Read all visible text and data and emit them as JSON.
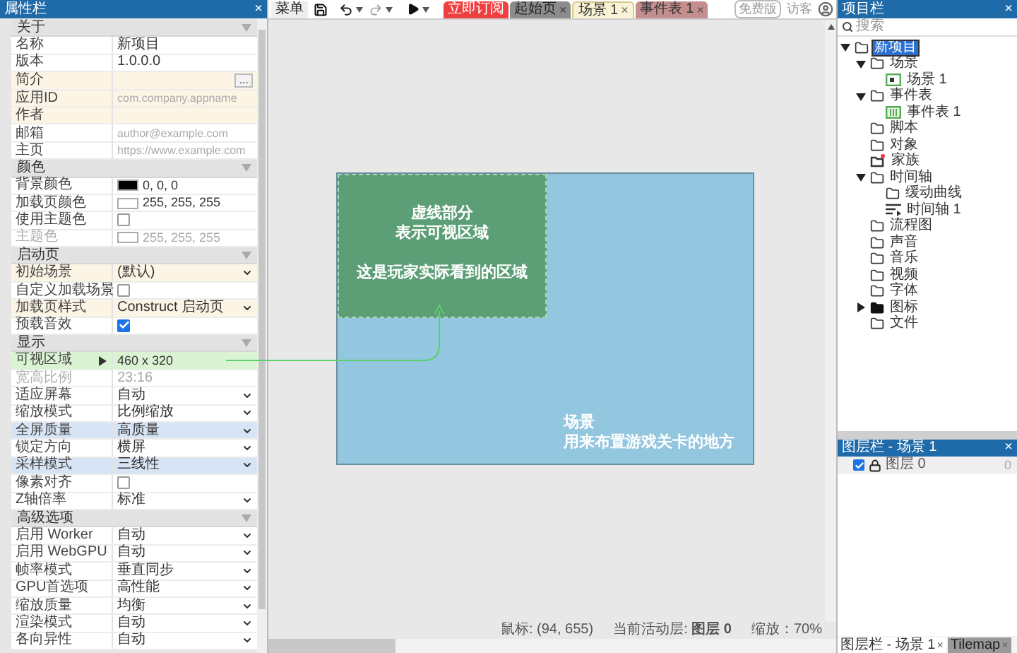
{
  "properties_panel": {
    "title": "属性栏",
    "close": "×",
    "rows": [
      {
        "kind": "section",
        "label": "关于",
        "expanded": true
      },
      {
        "kind": "text",
        "label": "名称",
        "value": "新项目"
      },
      {
        "kind": "text",
        "label": "版本",
        "value": "1.0.0.0"
      },
      {
        "kind": "button",
        "label": "简介",
        "button": "...",
        "color": "#fcf5e6"
      },
      {
        "kind": "placeholder",
        "label": "应用ID",
        "placeholder": "com.company.appname",
        "color": "#fcf5e6"
      },
      {
        "kind": "text",
        "label": "作者",
        "value": "",
        "color": "#fcf5e6"
      },
      {
        "kind": "placeholder",
        "label": "邮箱",
        "placeholder": "author@example.com"
      },
      {
        "kind": "placeholder",
        "label": "主页",
        "placeholder": "https://www.example.com"
      },
      {
        "kind": "section",
        "label": "颜色",
        "expanded": true
      },
      {
        "kind": "color",
        "label": "背景颜色",
        "swatch": {
          "color": "#000000"
        },
        "value": "0, 0, 0"
      },
      {
        "kind": "color",
        "label": "加载页颜色",
        "swatch": {
          "color": "#ffffff"
        },
        "value": "255, 255, 255"
      },
      {
        "kind": "checkbox",
        "label": "使用主题色",
        "checked": false
      },
      {
        "kind": "color",
        "label": "主题色",
        "swatch": {
          "color": "#ffffff"
        },
        "value": "255, 255, 255",
        "disabled": true
      },
      {
        "kind": "section",
        "label": "启动页",
        "expanded": true
      },
      {
        "kind": "select",
        "label": "初始场景",
        "value": "(默认)",
        "color": "#fcf5e6"
      },
      {
        "kind": "checkbox",
        "label": "自定义加载场景",
        "checked": false
      },
      {
        "kind": "select",
        "label": "加载页样式",
        "value": "Construct 启动页",
        "color": "#fcf5e6"
      },
      {
        "kind": "checkbox",
        "label": "预载音效",
        "checked": true
      },
      {
        "kind": "section",
        "label": "显示",
        "expanded": true
      },
      {
        "kind": "expand",
        "label": "可视区域",
        "value": "460 x 320",
        "expanded": false,
        "color": "#daf3d2"
      },
      {
        "kind": "text",
        "label": "宽高比例",
        "value": "23:16",
        "disabled": true
      },
      {
        "kind": "select",
        "label": "适应屏幕",
        "value": "自动"
      },
      {
        "kind": "select",
        "label": "缩放模式",
        "value": "比例缩放"
      },
      {
        "kind": "select",
        "label": "全屏质量",
        "value": "高质量",
        "color": "#d7e4f5"
      },
      {
        "kind": "select",
        "label": "锁定方向",
        "value": "横屏"
      },
      {
        "kind": "select",
        "label": "采样模式",
        "value": "三线性",
        "color": "#d7e4f5"
      },
      {
        "kind": "checkbox",
        "label": "像素对齐",
        "checked": false
      },
      {
        "kind": "select",
        "label": "Z轴倍率",
        "value": "标准"
      },
      {
        "kind": "section",
        "label": "高级选项",
        "expanded": true
      },
      {
        "kind": "select",
        "label": "启用 Worker",
        "value": "自动"
      },
      {
        "kind": "select",
        "label": "启用 WebGPU",
        "value": "自动"
      },
      {
        "kind": "select",
        "label": "帧率模式",
        "value": "垂直同步"
      },
      {
        "kind": "select",
        "label": "GPU首选项",
        "value": "高性能"
      },
      {
        "kind": "select",
        "label": "缩放质量",
        "value": "均衡"
      },
      {
        "kind": "select",
        "label": "渲染模式",
        "value": "自动"
      },
      {
        "kind": "select",
        "label": "各向异性",
        "value": "自动"
      }
    ]
  },
  "toolbar": {
    "menu": "菜单",
    "tabs": [
      {
        "label": "立即订阅",
        "kind": "promo",
        "selected": false
      },
      {
        "label": "起始页",
        "kind": "start",
        "selected": false,
        "close": "×"
      },
      {
        "label": "场景 1",
        "kind": "scene",
        "selected": true,
        "close": "×"
      },
      {
        "label": "事件表 1",
        "kind": "events",
        "selected": false,
        "close": "×"
      }
    ],
    "badge": "免费版",
    "user": "访客"
  },
  "canvas": {
    "viewport": {
      "title": "虚线部分",
      "subtitle": "表示可视区域",
      "note": "这是玩家实际看到的区域"
    },
    "scene": {
      "title": "场景",
      "note": "用来布置游戏关卡的地方"
    }
  },
  "status_bar": {
    "mouse": "鼠标: (94, 655)",
    "layer": "当前活动层: **图层 0**",
    "zoom": "缩放：70%"
  },
  "project_panel": {
    "title": "项目栏",
    "close": "×",
    "search": {
      "placeholder": "搜索"
    },
    "tree": [
      {
        "label": "新项目",
        "kind": "folder",
        "selected": true,
        "expanded": true,
        "children": [
          {
            "label": "场景",
            "kind": "folder",
            "selected": false,
            "expanded": true,
            "children": [
              {
                "label": "场景 1",
                "kind": "scene",
                "selected": false
              }
            ]
          },
          {
            "label": "事件表",
            "kind": "folder",
            "selected": false,
            "expanded": true,
            "children": [
              {
                "label": "事件表 1",
                "kind": "event-sheet",
                "selected": false
              }
            ]
          },
          {
            "label": "脚本",
            "kind": "folder",
            "selected": false
          },
          {
            "label": "对象",
            "kind": "folder",
            "selected": false
          },
          {
            "label": "家族",
            "kind": "family",
            "selected": false
          },
          {
            "label": "时间轴",
            "kind": "folder",
            "selected": false,
            "expanded": true,
            "children": [
              {
                "label": "缓动曲线",
                "kind": "folder",
                "selected": false
              },
              {
                "label": "时间轴 1",
                "kind": "timeline",
                "selected": false
              }
            ]
          },
          {
            "label": "流程图",
            "kind": "folder",
            "selected": false
          },
          {
            "label": "声音",
            "kind": "folder",
            "selected": false
          },
          {
            "label": "音乐",
            "kind": "folder",
            "selected": false
          },
          {
            "label": "视频",
            "kind": "folder",
            "selected": false
          },
          {
            "label": "字体",
            "kind": "folder",
            "selected": false
          },
          {
            "label": "图标",
            "kind": "filled-folder",
            "selected": false,
            "expanded": false
          },
          {
            "label": "文件",
            "kind": "folder",
            "selected": false
          }
        ]
      }
    ]
  },
  "layers_panel": {
    "title": "图层栏 - 场景 1",
    "close": "×",
    "layers": [
      {
        "name": "图层 0",
        "visible": true,
        "count": "0"
      }
    ],
    "tabs": [
      {
        "label": "图层栏 - 场景 1",
        "selected": true,
        "close": "×"
      },
      {
        "label": "Tilemap",
        "selected": false,
        "close": "×"
      }
    ]
  }
}
